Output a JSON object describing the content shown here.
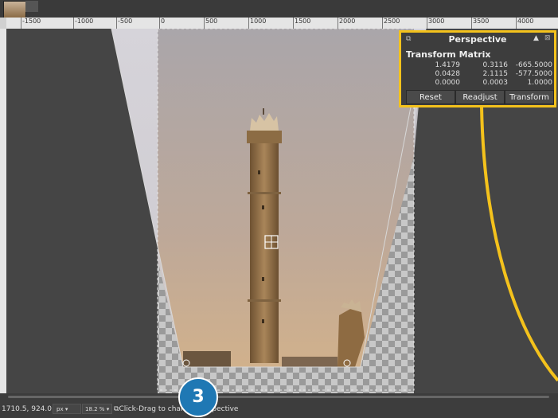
{
  "ruler": {
    "labels": [
      "-1500",
      "-1000",
      "-500",
      "0",
      "500",
      "1000",
      "1500",
      "2000",
      "2500",
      "3000",
      "3500",
      "4000"
    ]
  },
  "perspective": {
    "title": "Perspective",
    "matrix_title": "Transform Matrix",
    "matrix": [
      [
        "1.4179",
        "0.3116",
        "-665.5000"
      ],
      [
        "0.0428",
        "2.1115",
        "-577.5000"
      ],
      [
        "0.0000",
        "0.0003",
        "1.0000"
      ]
    ],
    "reset": "Reset",
    "readjust": "Readjust",
    "transform": "Transform"
  },
  "status": {
    "coords": "1710.5, 924.0",
    "unit": "px",
    "zoom": "18.2 %",
    "message": "Click-Drag to change perspective"
  },
  "badge": "3",
  "colors": {
    "highlight": "#f4c21c",
    "badge": "#1f78b4"
  }
}
